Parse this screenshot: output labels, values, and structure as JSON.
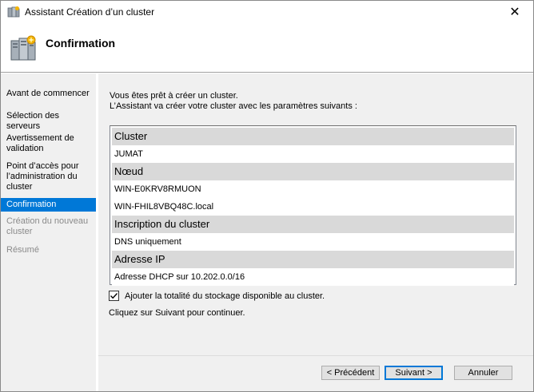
{
  "window": {
    "title": "Assistant Création d’un cluster",
    "close_glyph": "✕"
  },
  "header": {
    "title": "Confirmation",
    "icon": "cluster-servers-icon"
  },
  "sidebar": {
    "items": [
      {
        "label": "Avant de commencer",
        "state": "normal"
      },
      {
        "label": "Sélection des serveurs",
        "state": "normal"
      },
      {
        "label": "Avertissement de validation",
        "state": "normal"
      },
      {
        "label": "Point d’accès pour l’administration du cluster",
        "state": "normal"
      },
      {
        "label": "Confirmation",
        "state": "active"
      },
      {
        "label": "Création du nouveau cluster",
        "state": "disabled"
      },
      {
        "label": "Résumé",
        "state": "disabled"
      }
    ]
  },
  "main": {
    "intro_line1": "Vous êtes prêt à créer un cluster.",
    "intro_line2": "L’Assistant va créer votre cluster avec les paramètres suivants :",
    "summary": {
      "cluster_header": "Cluster",
      "cluster_value": "JUMAT",
      "node_header": "Nœud",
      "node_value_1": "WIN-E0KRV8RMUON",
      "node_value_2": "WIN-FHIL8VBQ48C.local",
      "registration_header": "Inscription du cluster",
      "registration_value": "DNS uniquement",
      "ip_header": "Adresse IP",
      "ip_value": "Adresse DHCP sur 10.202.0.0/16"
    },
    "storage_checkbox": {
      "checked": true,
      "label": "Ajouter la totalité du stockage disponible au cluster."
    },
    "continue_text": "Cliquez sur Suivant pour continuer."
  },
  "buttons": {
    "previous": "< Précédent",
    "next": "Suivant >",
    "cancel": "Annuler"
  },
  "colors": {
    "accent": "#0078d7",
    "panel": "#f0f0f0",
    "section_header": "#d9d9d9"
  }
}
